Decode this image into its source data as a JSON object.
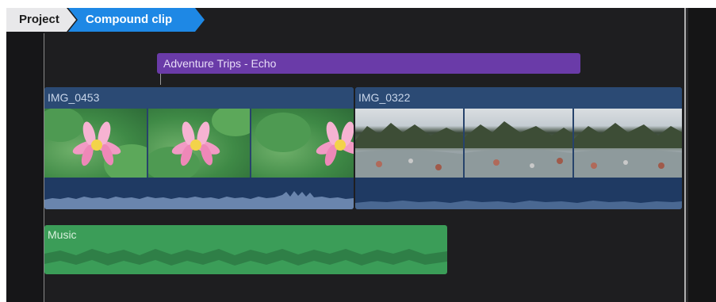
{
  "breadcrumb": {
    "project_label": "Project",
    "compound_label": "Compound clip"
  },
  "timeline": {
    "title_clip": {
      "label": "Adventure Trips - Echo",
      "color": "#6a3ba8"
    },
    "video_clips": [
      {
        "name": "IMG_0453",
        "thumbnail": "lotus-flower"
      },
      {
        "name": "IMG_0322",
        "thumbnail": "river-landscape"
      }
    ],
    "music_clip": {
      "label": "Music",
      "color": "#3b9d58"
    }
  },
  "colors": {
    "background": "#1e1e20",
    "accent": "#1e88e5",
    "video_clip": "#27436b"
  }
}
